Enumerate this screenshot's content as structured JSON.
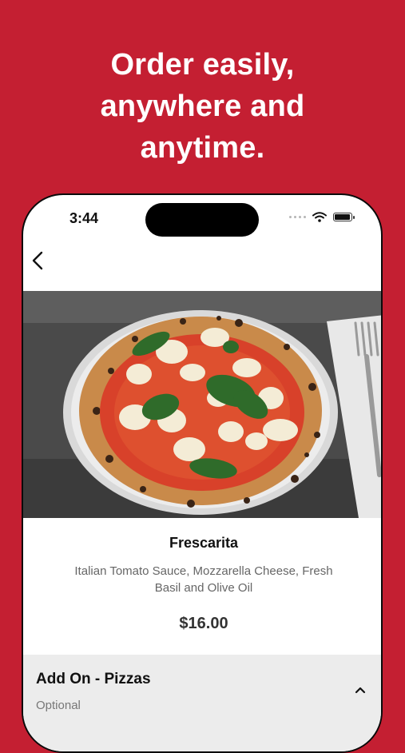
{
  "headline": {
    "line1": "Order easily,",
    "line2": "anywhere and",
    "line3": "anytime."
  },
  "status_bar": {
    "time": "3:44"
  },
  "product": {
    "name": "Frescarita",
    "description": "Italian Tomato Sauce, Mozzarella Cheese, Fresh Basil and Olive Oil",
    "price": "$16.00"
  },
  "addon_section": {
    "title": "Add On - Pizzas",
    "subtitle": "Optional"
  },
  "colors": {
    "brand_red": "#c41f32",
    "text_dark": "#111111",
    "text_muted": "#666666",
    "section_bg": "#ececec"
  },
  "icons": [
    "back-chevron-icon",
    "wifi-icon",
    "battery-icon",
    "chevron-up-icon"
  ]
}
